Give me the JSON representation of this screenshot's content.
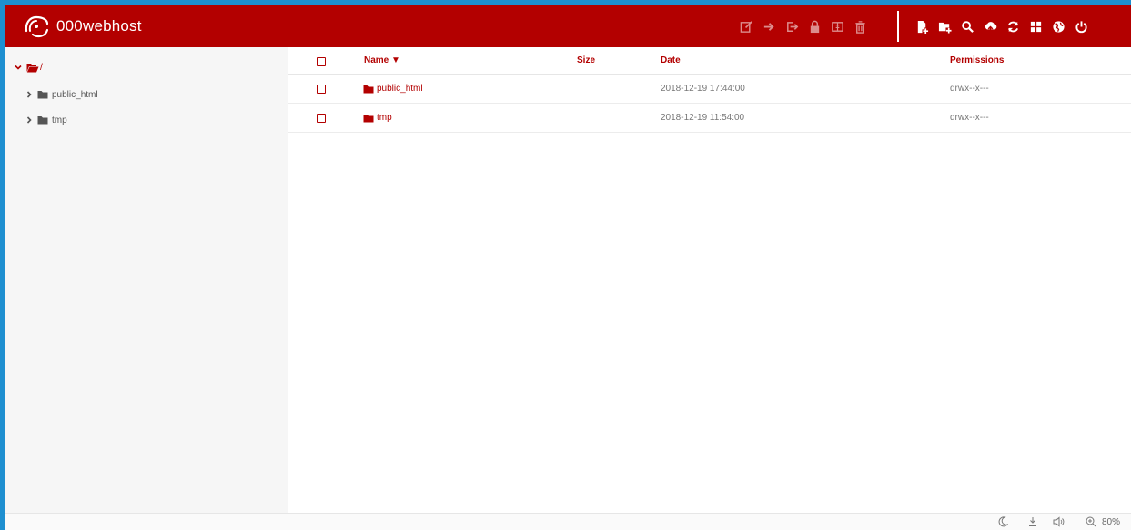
{
  "brand": {
    "name": "000webhost",
    "header_color": "#b30000",
    "accent_color": "#1e8fd0"
  },
  "toolbar": {
    "selection_actions": [
      "edit-icon",
      "move-icon",
      "copy-icon",
      "lock-icon",
      "archive-icon",
      "trash-icon"
    ],
    "main_actions": [
      "new-file-icon",
      "new-folder-icon",
      "search-icon",
      "upload-icon",
      "refresh-icon",
      "grid-view-icon",
      "globe-icon",
      "power-icon"
    ]
  },
  "sidebar": {
    "root_label": "/",
    "items": [
      {
        "label": "public_html"
      },
      {
        "label": "tmp"
      }
    ]
  },
  "table": {
    "columns": {
      "name": "Name ▼",
      "size": "Size",
      "date": "Date",
      "permissions": "Permissions"
    },
    "rows": [
      {
        "name": "public_html",
        "size": "",
        "date": "2018-12-19 17:44:00",
        "permissions": "drwx--x---"
      },
      {
        "name": "tmp",
        "size": "",
        "date": "2018-12-19 11:54:00",
        "permissions": "drwx--x---"
      }
    ]
  },
  "statusbar": {
    "zoom": "80%"
  }
}
